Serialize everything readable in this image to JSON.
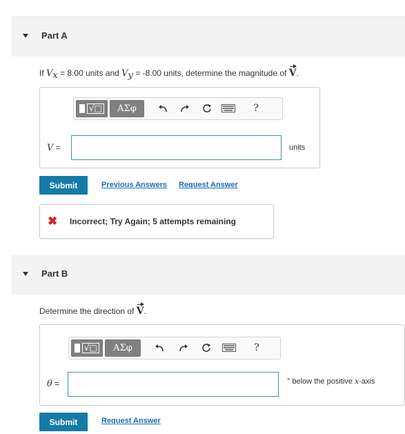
{
  "part_a": {
    "title": "Part A",
    "question_prefix": "If",
    "question_v1": "V",
    "question_v1_sub": "x",
    "question_mid1": " = 8.00 units and ",
    "question_v2": "V",
    "question_v2_sub": "y",
    "question_mid2": " = -8.00 units, determine the magnitude of ",
    "question_vec": "V",
    "question_end": ".",
    "toolbar": {
      "template_icon": "fraction-radical-template-icon",
      "greek_label": "ΑΣφ",
      "undo_icon": "undo-icon",
      "redo_icon": "redo-icon",
      "reset_icon": "reset-icon",
      "keyboard_icon": "keyboard-icon",
      "help_label": "?"
    },
    "var_symbol": "V",
    "var_eq": " =",
    "input_value": "",
    "unit": "units",
    "submit_label": "Submit",
    "previous_answers_label": "Previous Answers",
    "request_answer_label": "Request Answer",
    "feedback_icon": "x-icon",
    "feedback_mark": "✖",
    "feedback_text": "Incorrect; Try Again; 5 attempts remaining"
  },
  "part_b": {
    "title": "Part B",
    "question_prefix": "Determine the direction of ",
    "question_vec": "V",
    "question_end": ".",
    "toolbar": {
      "greek_label": "ΑΣφ",
      "help_label": "?"
    },
    "var_symbol": "θ",
    "var_eq": " =",
    "input_value": "",
    "unit_degree": "°",
    "unit_text1": " below the positive ",
    "unit_axis": "x",
    "unit_text2": "-axis",
    "submit_label": "Submit",
    "request_answer_label": "Request Answer"
  },
  "colors": {
    "header_bg": "#f3f3f3",
    "submit_bg": "#147ba8",
    "link": "#1d6fb8",
    "input_border": "#3b8fbf",
    "error": "#d9212a",
    "toolbar_button": "#808080"
  }
}
